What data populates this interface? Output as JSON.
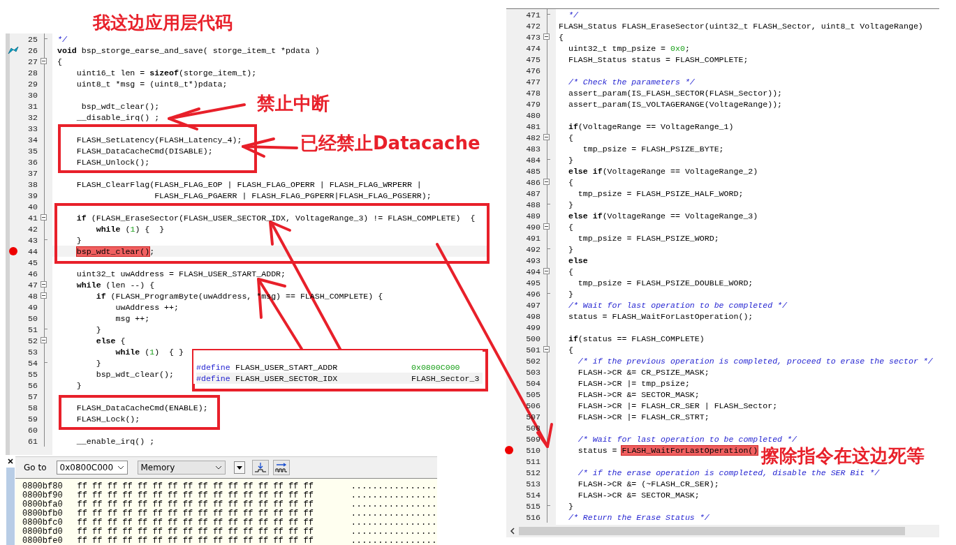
{
  "annotations": {
    "title": "我这边应用层代码",
    "labels": [
      "禁止中断",
      "已经禁止Datacache",
      "擦除指令在这边死等"
    ]
  },
  "left_editor": {
    "lines": [
      {
        "number": "25",
        "fold_end": true,
        "parts": [
          {
            "text": "*/",
            "kind": "comment"
          }
        ]
      },
      {
        "number": "26",
        "execution_arrow": true,
        "parts": [
          {
            "text": "void",
            "kind": "keyword"
          },
          {
            "text": " bsp_storge_earse_and_save( storge_item_t *pdata )"
          }
        ]
      },
      {
        "number": "27",
        "fold_open": true,
        "parts": [
          {
            "text": "{"
          }
        ]
      },
      {
        "number": "28",
        "parts": [
          {
            "text": "    uint16_t len = "
          },
          {
            "text": "sizeof",
            "kind": "keyword"
          },
          {
            "text": "(storge_item_t);"
          }
        ]
      },
      {
        "number": "29",
        "parts": [
          {
            "text": "    uint8_t *msg = (uint8_t*)pdata;"
          }
        ]
      },
      {
        "number": "30"
      },
      {
        "number": "31",
        "parts": [
          {
            "text": "     bsp_wdt_clear();"
          }
        ]
      },
      {
        "number": "32",
        "parts": [
          {
            "text": "    __disable_irq() ;"
          }
        ]
      },
      {
        "number": "33"
      },
      {
        "number": "34",
        "parts": [
          {
            "text": "    FLASH_SetLatency(FLASH_Latency_4);"
          }
        ]
      },
      {
        "number": "35",
        "parts": [
          {
            "text": "    FLASH_DataCacheCmd(DISABLE);"
          }
        ]
      },
      {
        "number": "36",
        "parts": [
          {
            "text": "    FLASH_Unlock();"
          }
        ]
      },
      {
        "number": "37"
      },
      {
        "number": "38",
        "parts": [
          {
            "text": "    FLASH_ClearFlag(FLASH_FLAG_EOP | FLASH_FLAG_OPERR | FLASH_FLAG_WRPERR |"
          }
        ]
      },
      {
        "number": "39",
        "parts": [
          {
            "text": "                    FLASH_FLAG_PGAERR | FLASH_FLAG_PGPERR|FLASH_FLAG_PGSERR);"
          }
        ]
      },
      {
        "number": "40"
      },
      {
        "number": "41",
        "fold_open": true,
        "parts": [
          {
            "text": "    if",
            "kind": "keyword"
          },
          {
            "text": " (FLASH_EraseSector(FLASH_USER_SECTOR_IDX, VoltageRange_3) != FLASH_COMPLETE)  {"
          }
        ]
      },
      {
        "number": "42",
        "parts": [
          {
            "text": "        while",
            "kind": "keyword"
          },
          {
            "text": " ("
          },
          {
            "text": "1",
            "kind": "number"
          },
          {
            "text": ") {  }"
          }
        ]
      },
      {
        "number": "43",
        "fold_end": true,
        "parts": [
          {
            "text": "    }"
          }
        ]
      },
      {
        "number": "44",
        "breakpoint": true,
        "highlighted": true,
        "parts": [
          {
            "text": "    bsp_wdt_clear()",
            "kind": "marked"
          },
          {
            "text": ";"
          }
        ]
      },
      {
        "number": "45"
      },
      {
        "number": "46",
        "parts": [
          {
            "text": "    uint32_t uwAddress = FLASH_USER_START_ADDR;"
          }
        ]
      },
      {
        "number": "47",
        "fold_open": true,
        "parts": [
          {
            "text": "    while",
            "kind": "keyword"
          },
          {
            "text": " (len --) {"
          }
        ]
      },
      {
        "number": "48",
        "fold_open": true,
        "parts": [
          {
            "text": "        if",
            "kind": "keyword"
          },
          {
            "text": " (FLASH_ProgramByte(uwAddress, *msg) == FLASH_COMPLETE) {"
          }
        ]
      },
      {
        "number": "49",
        "parts": [
          {
            "text": "            uwAddress ++;"
          }
        ]
      },
      {
        "number": "50",
        "parts": [
          {
            "text": "            msg ++;"
          }
        ]
      },
      {
        "number": "51",
        "fold_end": true,
        "parts": [
          {
            "text": "        }"
          }
        ]
      },
      {
        "number": "52",
        "fold_open": true,
        "parts": [
          {
            "text": "        else",
            "kind": "keyword"
          },
          {
            "text": " {"
          }
        ]
      },
      {
        "number": "53",
        "parts": [
          {
            "text": "            while",
            "kind": "keyword"
          },
          {
            "text": " ("
          },
          {
            "text": "1",
            "kind": "number"
          },
          {
            "text": ")  { }"
          }
        ]
      },
      {
        "number": "54",
        "fold_end": true,
        "parts": [
          {
            "text": "        }"
          }
        ]
      },
      {
        "number": "55",
        "parts": [
          {
            "text": "        bsp_wdt_clear();"
          }
        ]
      },
      {
        "number": "56",
        "parts": [
          {
            "text": "    }"
          }
        ]
      },
      {
        "number": "57"
      },
      {
        "number": "58",
        "parts": [
          {
            "text": "    FLASH_DataCacheCmd(ENABLE);"
          }
        ]
      },
      {
        "number": "59",
        "parts": [
          {
            "text": "    FLASH_Lock();"
          }
        ]
      },
      {
        "number": "60"
      },
      {
        "number": "61",
        "parts": [
          {
            "text": "    __enable_irq() ;"
          }
        ]
      }
    ]
  },
  "define_popup": {
    "rows": [
      {
        "directive": "#define",
        "name": "FLASH_USER_START_ADDR",
        "value": "0x0800C000",
        "kind": "number",
        "selected": false
      },
      {
        "directive": "#define",
        "name": "FLASH_USER_SECTOR_IDX",
        "value": "FLASH_Sector_3",
        "kind": "plain",
        "selected": true
      }
    ]
  },
  "memory": {
    "goto_label": "Go to",
    "address": "0x0800C000",
    "view": "Memory",
    "rows": [
      {
        "address": "0800bf80",
        "bytes": "ff ff ff ff ff ff ff ff ff ff ff ff ff ff ff ff",
        "ascii": "................"
      },
      {
        "address": "0800bf90",
        "bytes": "ff ff ff ff ff ff ff ff ff ff ff ff ff ff ff ff",
        "ascii": "................"
      },
      {
        "address": "0800bfa0",
        "bytes": "ff ff ff ff ff ff ff ff ff ff ff ff ff ff ff ff",
        "ascii": "................"
      },
      {
        "address": "0800bfb0",
        "bytes": "ff ff ff ff ff ff ff ff ff ff ff ff ff ff ff ff",
        "ascii": "................"
      },
      {
        "address": "0800bfc0",
        "bytes": "ff ff ff ff ff ff ff ff ff ff ff ff ff ff ff ff",
        "ascii": "................"
      },
      {
        "address": "0800bfd0",
        "bytes": "ff ff ff ff ff ff ff ff ff ff ff ff ff ff ff ff",
        "ascii": "................"
      },
      {
        "address": "0800bfe0",
        "bytes": "ff ff ff ff ff ff ff ff ff ff ff ff ff ff ff ff",
        "ascii": "................"
      }
    ]
  },
  "right_editor": {
    "lines": [
      {
        "number": "471",
        "fold_end": true,
        "parts": [
          {
            "text": "  */",
            "kind": "comment"
          }
        ]
      },
      {
        "number": "472",
        "parts": [
          {
            "text": "FLASH_Status FLASH_EraseSector(uint32_t FLASH_Sector, uint8_t VoltageRange)"
          }
        ]
      },
      {
        "number": "473",
        "fold_open": true,
        "parts": [
          {
            "text": "{"
          }
        ]
      },
      {
        "number": "474",
        "parts": [
          {
            "text": "  uint32_t tmp_psize = "
          },
          {
            "text": "0x0",
            "kind": "number"
          },
          {
            "text": ";"
          }
        ]
      },
      {
        "number": "475",
        "parts": [
          {
            "text": "  FLASH_Status status = FLASH_COMPLETE;"
          }
        ]
      },
      {
        "number": "476"
      },
      {
        "number": "477",
        "parts": [
          {
            "text": "  /* Check the parameters */",
            "kind": "comment"
          }
        ]
      },
      {
        "number": "478",
        "parts": [
          {
            "text": "  assert_param(IS_FLASH_SECTOR(FLASH_Sector));"
          }
        ]
      },
      {
        "number": "479",
        "parts": [
          {
            "text": "  assert_param(IS_VOLTAGERANGE(VoltageRange));"
          }
        ]
      },
      {
        "number": "480"
      },
      {
        "number": "481",
        "parts": [
          {
            "text": "  if",
            "kind": "keyword"
          },
          {
            "text": "(VoltageRange == VoltageRange_1)"
          }
        ]
      },
      {
        "number": "482",
        "fold_open": true,
        "parts": [
          {
            "text": "  {"
          }
        ]
      },
      {
        "number": "483",
        "parts": [
          {
            "text": "     tmp_psize = FLASH_PSIZE_BYTE;"
          }
        ]
      },
      {
        "number": "484",
        "fold_end": true,
        "parts": [
          {
            "text": "  }"
          }
        ]
      },
      {
        "number": "485",
        "parts": [
          {
            "text": "  else if",
            "kind": "keyword"
          },
          {
            "text": "(VoltageRange == VoltageRange_2)"
          }
        ]
      },
      {
        "number": "486",
        "fold_open": true,
        "parts": [
          {
            "text": "  {"
          }
        ]
      },
      {
        "number": "487",
        "parts": [
          {
            "text": "    tmp_psize = FLASH_PSIZE_HALF_WORD;"
          }
        ]
      },
      {
        "number": "488",
        "fold_end": true,
        "parts": [
          {
            "text": "  }"
          }
        ]
      },
      {
        "number": "489",
        "parts": [
          {
            "text": "  else if",
            "kind": "keyword"
          },
          {
            "text": "(VoltageRange == VoltageRange_3)"
          }
        ]
      },
      {
        "number": "490",
        "fold_open": true,
        "parts": [
          {
            "text": "  {"
          }
        ]
      },
      {
        "number": "491",
        "parts": [
          {
            "text": "    tmp_psize = FLASH_PSIZE_WORD;"
          }
        ]
      },
      {
        "number": "492",
        "fold_end": true,
        "parts": [
          {
            "text": "  }"
          }
        ]
      },
      {
        "number": "493",
        "parts": [
          {
            "text": "  else",
            "kind": "keyword"
          }
        ]
      },
      {
        "number": "494",
        "fold_open": true,
        "parts": [
          {
            "text": "  {"
          }
        ]
      },
      {
        "number": "495",
        "parts": [
          {
            "text": "    tmp_psize = FLASH_PSIZE_DOUBLE_WORD;"
          }
        ]
      },
      {
        "number": "496",
        "fold_end": true,
        "parts": [
          {
            "text": "  }"
          }
        ]
      },
      {
        "number": "497",
        "parts": [
          {
            "text": "  /* Wait for last operation to be completed */",
            "kind": "comment"
          }
        ]
      },
      {
        "number": "498",
        "parts": [
          {
            "text": "  status = FLASH_WaitForLastOperation();"
          }
        ]
      },
      {
        "number": "499"
      },
      {
        "number": "500",
        "parts": [
          {
            "text": "  if",
            "kind": "keyword"
          },
          {
            "text": "(status == FLASH_COMPLETE)"
          }
        ]
      },
      {
        "number": "501",
        "fold_open": true,
        "parts": [
          {
            "text": "  {"
          }
        ]
      },
      {
        "number": "502",
        "parts": [
          {
            "text": "    /* if the previous operation is completed, proceed to erase the sector */",
            "kind": "comment"
          }
        ]
      },
      {
        "number": "503",
        "parts": [
          {
            "text": "    FLASH->CR &= CR_PSIZE_MASK;"
          }
        ]
      },
      {
        "number": "504",
        "parts": [
          {
            "text": "    FLASH->CR |= tmp_psize;"
          }
        ]
      },
      {
        "number": "505",
        "parts": [
          {
            "text": "    FLASH->CR &= SECTOR_MASK;"
          }
        ]
      },
      {
        "number": "506",
        "parts": [
          {
            "text": "    FLASH->CR |= FLASH_CR_SER | FLASH_Sector;"
          }
        ]
      },
      {
        "number": "507",
        "parts": [
          {
            "text": "    FLASH->CR |= FLASH_CR_STRT;"
          }
        ]
      },
      {
        "number": "508"
      },
      {
        "number": "509",
        "parts": [
          {
            "text": "    /* Wait for last operation to be completed */",
            "kind": "comment"
          }
        ]
      },
      {
        "number": "510",
        "breakpoint": true,
        "parts": [
          {
            "text": "    status = "
          },
          {
            "text": "FLASH_WaitForLastOperation()",
            "kind": "marked"
          }
        ]
      },
      {
        "number": "511"
      },
      {
        "number": "512",
        "parts": [
          {
            "text": "    /* if the erase operation is completed, disable the SER Bit */",
            "kind": "comment"
          }
        ]
      },
      {
        "number": "513",
        "parts": [
          {
            "text": "    FLASH->CR &= (~FLASH_CR_SER);"
          }
        ]
      },
      {
        "number": "514",
        "parts": [
          {
            "text": "    FLASH->CR &= SECTOR_MASK;"
          }
        ]
      },
      {
        "number": "515",
        "fold_end": true,
        "parts": [
          {
            "text": "  }"
          }
        ]
      },
      {
        "number": "516",
        "parts": [
          {
            "text": "  /* Return the Erase Status */",
            "kind": "comment"
          }
        ]
      }
    ]
  }
}
